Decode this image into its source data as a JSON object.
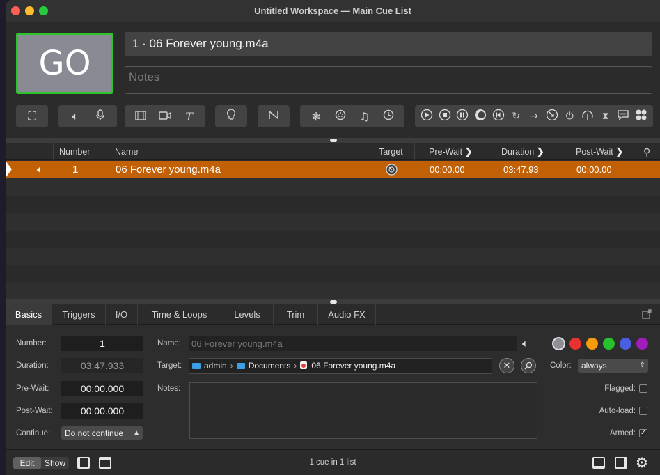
{
  "window": {
    "title": "Untitled Workspace — Main Cue List"
  },
  "go": {
    "label": "GO"
  },
  "cue_header": {
    "name": "1 · 06 Forever young.m4a",
    "notes_placeholder": "Notes"
  },
  "toolbar": {
    "groups": [
      [
        "fullscreen-icon"
      ],
      [
        "speaker-icon",
        "microphone-icon"
      ],
      [
        "film-icon",
        "camera-icon",
        "text-icon"
      ],
      [
        "lightbulb-icon"
      ],
      [
        "network-icon"
      ],
      [
        "midi-icon",
        "timecode-icon",
        "music-note-icon",
        "clock-icon"
      ],
      [
        "start-icon",
        "stop-icon",
        "pause-icon",
        "load-icon",
        "reset-icon",
        "goto-icon",
        "target-arrow-icon",
        "arm-icon",
        "disarm-icon",
        "devamp-icon",
        "wait-icon",
        "memo-icon",
        "group-icon"
      ]
    ]
  },
  "cue_list": {
    "columns": {
      "number": "Number",
      "name": "Name",
      "target": "Target",
      "pre_wait": "Pre-Wait",
      "duration": "Duration",
      "post_wait": "Post-Wait"
    },
    "rows": [
      {
        "number": "1",
        "name": "06 Forever young.m4a",
        "pre_wait": "00:00.00",
        "duration": "03:47.93",
        "post_wait": "00:00.00",
        "type_icon": "speaker-icon",
        "target_icon": "target-icon"
      }
    ]
  },
  "inspector": {
    "tabs": [
      "Basics",
      "Triggers",
      "I/O",
      "Time & Loops",
      "Levels",
      "Trim",
      "Audio FX"
    ],
    "active_tab": "Basics",
    "labels": {
      "number": "Number:",
      "duration": "Duration:",
      "pre_wait": "Pre-Wait:",
      "post_wait": "Post-Wait:",
      "continue": "Continue:",
      "name": "Name:",
      "target": "Target:",
      "notes": "Notes:",
      "color": "Color:",
      "flagged": "Flagged:",
      "auto_load": "Auto-load:",
      "armed": "Armed:"
    },
    "values": {
      "number": "1",
      "duration": "03:47.933",
      "pre_wait": "00:00.000",
      "post_wait": "00:00.000",
      "continue": "Do not continue",
      "name_placeholder": "06 Forever young.m4a",
      "color": "always"
    },
    "target_path": [
      "admin",
      "Documents",
      "06 Forever young.m4a"
    ],
    "colors": [
      "#8e8e96",
      "#e8322f",
      "#f59b0c",
      "#27c12d",
      "#4a5ee0",
      "#a21cbd"
    ],
    "flagged": false,
    "auto_load": false,
    "armed": true
  },
  "statusbar": {
    "mode_edit": "Edit",
    "mode_show": "Show",
    "status": "1 cue in 1 list"
  }
}
